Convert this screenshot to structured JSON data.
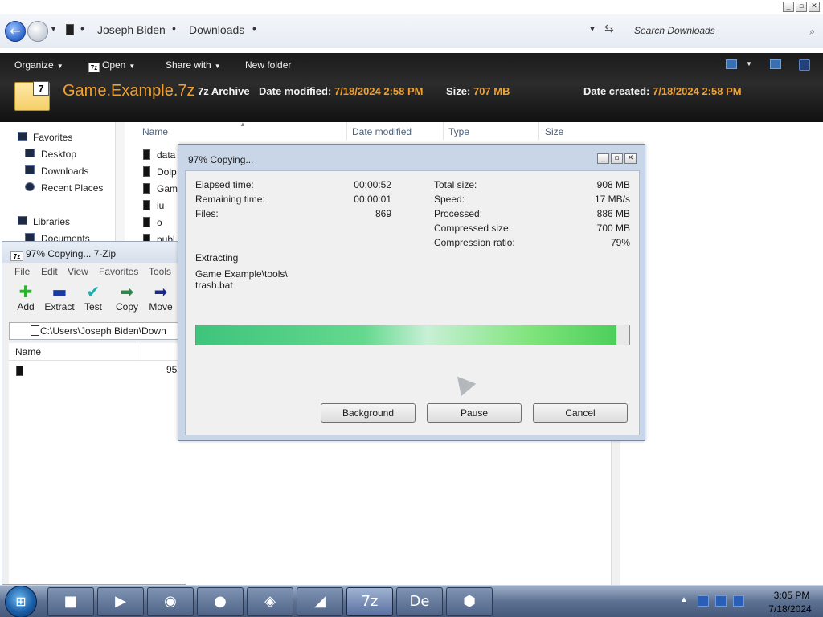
{
  "explorer": {
    "breadcrumb": [
      "Joseph Biden",
      "Downloads"
    ],
    "search_placeholder": "Search Downloads",
    "commands": {
      "organize": "Organize",
      "open": "Open",
      "share_with": "Share with",
      "new_folder": "New folder"
    },
    "file": {
      "name": "Game.Example.7z",
      "type": "7z Archive",
      "date_modified_label": "Date modified:",
      "date_modified": "7/18/2024 2:58 PM",
      "size_label": "Size:",
      "size": "707 MB",
      "date_created_label": "Date created:",
      "date_created": "7/18/2024 2:58 PM"
    },
    "nav": {
      "favorites": "Favorites",
      "desktop": "Desktop",
      "downloads": "Downloads",
      "recent": "Recent Places",
      "libraries": "Libraries",
      "documents": "Documents"
    },
    "columns": [
      "Name",
      "Date modified",
      "Type",
      "Size"
    ],
    "rows": [
      "data",
      "Dolp",
      "Gam",
      "iu",
      "o",
      "publ"
    ]
  },
  "zip_manager": {
    "title": "97% Copying... 7-Zip",
    "menu": [
      "File",
      "Edit",
      "View",
      "Favorites",
      "Tools"
    ],
    "toolbar": [
      "Add",
      "Extract",
      "Test",
      "Copy",
      "Move"
    ],
    "path": "C:\\Users\\Joseph Biden\\Down",
    "list_header": "Name",
    "row_size": "95:"
  },
  "copy_dialog": {
    "title": "97% Copying...",
    "elapsed_label": "Elapsed time:",
    "elapsed": "00:00:52",
    "remaining_label": "Remaining time:",
    "remaining": "00:00:01",
    "files_label": "Files:",
    "files": "869",
    "total_size_label": "Total size:",
    "total_size": "908 MB",
    "speed_label": "Speed:",
    "speed": "17 MB/s",
    "processed_label": "Processed:",
    "processed": "886 MB",
    "compressed_label": "Compressed size:",
    "compressed": "700 MB",
    "ratio_label": "Compression ratio:",
    "ratio": "79%",
    "operation": "Extracting",
    "current_path": "Game Example\\tools\\",
    "current_file": "trash.bat",
    "progress": 0.97,
    "buttons": {
      "background": "Background",
      "pause": "Pause",
      "cancel": "Cancel"
    }
  },
  "taskbar": {
    "time": "3:05 PM",
    "date": "7/18/2024"
  },
  "colors": {
    "accent_orange": "#f0a030",
    "progress_green": "#4ccf5a",
    "cmdbar_bg": "#1b1b1b"
  }
}
